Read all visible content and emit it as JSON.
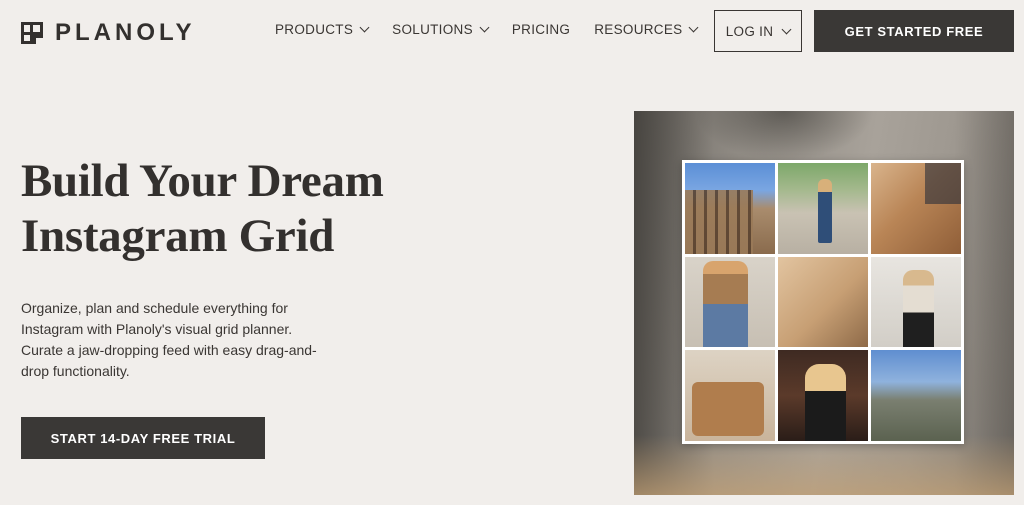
{
  "brand": {
    "name": "PLANOLY"
  },
  "nav": {
    "items": [
      {
        "label": "PRODUCTS",
        "has_dropdown": true
      },
      {
        "label": "SOLUTIONS",
        "has_dropdown": true
      },
      {
        "label": "PRICING",
        "has_dropdown": false
      },
      {
        "label": "RESOURCES",
        "has_dropdown": true
      }
    ],
    "login_label": "LOG IN",
    "cta_label": "GET STARTED FREE"
  },
  "hero": {
    "headline_line1": "Build Your Dream",
    "headline_line2": "Instagram Grid",
    "subtext": "Organize, plan and schedule everything for Instagram with Planoly's visual grid planner. Curate a jaw-dropping feed with easy drag-and-drop functionality.",
    "cta_label": "START 14-DAY FREE TRIAL"
  },
  "colors": {
    "background": "#f1eeeb",
    "text": "#33302e",
    "button_dark": "#3a3836",
    "button_text": "#ffffff"
  }
}
